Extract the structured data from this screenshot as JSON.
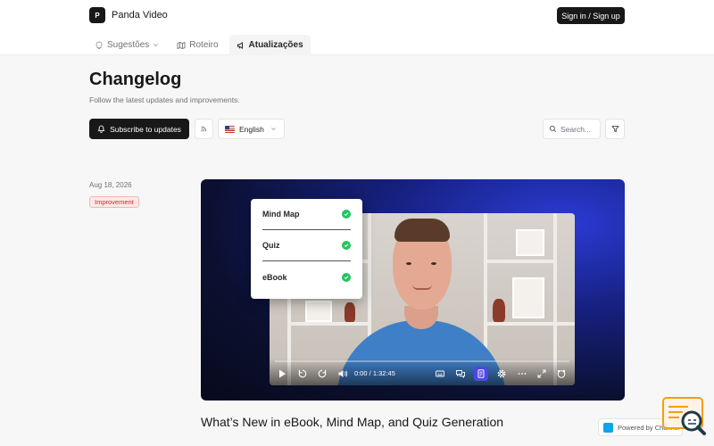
{
  "brand": {
    "logo_letter": "P",
    "name": "Panda Video"
  },
  "header": {
    "signin_label": "Sign in / Sign up"
  },
  "tabs": [
    {
      "label": "Sugestões",
      "icon": "lightbulb-icon"
    },
    {
      "label": "Roteiro",
      "icon": "map-icon"
    },
    {
      "label": "Atualizações",
      "icon": "megaphone-icon",
      "active": true
    }
  ],
  "page": {
    "title": "Changelog",
    "subtitle": "Follow the latest updates and improvements."
  },
  "toolbar": {
    "subscribe_label": "Subscribe to updates",
    "language": "English",
    "search_placeholder": "Search..."
  },
  "post": {
    "date": "Aug 18, 2026",
    "tag": "Improvement",
    "title": "What’s New in eBook, Mind Map, and Quiz Generation",
    "checklist": [
      "Mind Map",
      "Quiz",
      "eBook"
    ],
    "player": {
      "time": "0:00 / 1:32:45",
      "progress": 0
    }
  },
  "footer": {
    "powered_by": "Powered by Channel"
  },
  "colors": {
    "primary": "#18181b",
    "accent": "#4f46e5",
    "check": "#22c55e",
    "badge": "#dc2626"
  }
}
